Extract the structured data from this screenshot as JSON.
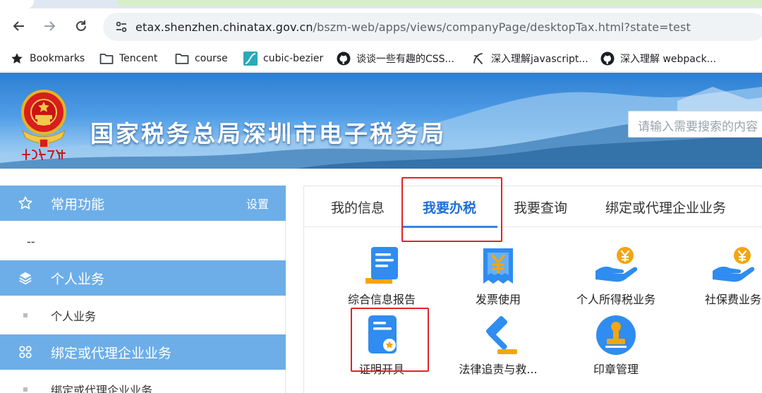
{
  "browser": {
    "url_host": "etax.shenzhen.chinatax.gov.cn",
    "url_path": "/bszm-web/apps/views/companyPage/desktopTax.html?state=test",
    "bookmarks": [
      {
        "label": "Bookmarks",
        "icon": "star-icon"
      },
      {
        "label": "Tencent",
        "icon": "folder-icon"
      },
      {
        "label": "course",
        "icon": "folder-icon"
      },
      {
        "label": "cubic-bezier",
        "icon": "cubic-bezier-favicon"
      },
      {
        "label": "谈谈一些有趣的CSS...",
        "icon": "github-icon"
      },
      {
        "label": "深入理解javascript...",
        "icon": "blog-favicon"
      },
      {
        "label": "深入理解 webpack...",
        "icon": "github-icon"
      }
    ]
  },
  "banner": {
    "emblem_caption": "中国税务",
    "site_title": "国家税务总局深圳市电子税务局",
    "search_placeholder": "请输入需要搜索的内容"
  },
  "sidebar": {
    "sections": [
      {
        "title": "常用功能",
        "action": "设置",
        "icon": "star-outline-icon",
        "items": [
          "--"
        ]
      },
      {
        "title": "个人业务",
        "icon": "layers-icon",
        "items": [
          "个人业务"
        ]
      },
      {
        "title": "绑定或代理企业业务",
        "icon": "grid-icon",
        "items": [
          "绑定或代理企业业务"
        ]
      }
    ]
  },
  "main": {
    "tabs": [
      {
        "label": "我的信息",
        "active": false
      },
      {
        "label": "我要办税",
        "active": true
      },
      {
        "label": "我要查询",
        "active": false
      },
      {
        "label": "绑定或代理企业业务",
        "active": false
      }
    ],
    "services": [
      {
        "label": "综合信息报告",
        "icon": "report-icon"
      },
      {
        "label": "发票使用",
        "icon": "invoice-yuan-icon"
      },
      {
        "label": "个人所得税业务",
        "icon": "hand-coin-icon"
      },
      {
        "label": "社保费业务",
        "icon": "hand-coin-icon"
      },
      {
        "label": "证明开具",
        "icon": "certificate-icon"
      },
      {
        "label": "法律追责与救...",
        "icon": "gavel-icon"
      },
      {
        "label": "印章管理",
        "icon": "seal-stamp-icon"
      }
    ]
  },
  "colors": {
    "accent": "#1f6fd1",
    "sidebar_header": "#6daee8",
    "highlight_box": "#e0242a"
  }
}
